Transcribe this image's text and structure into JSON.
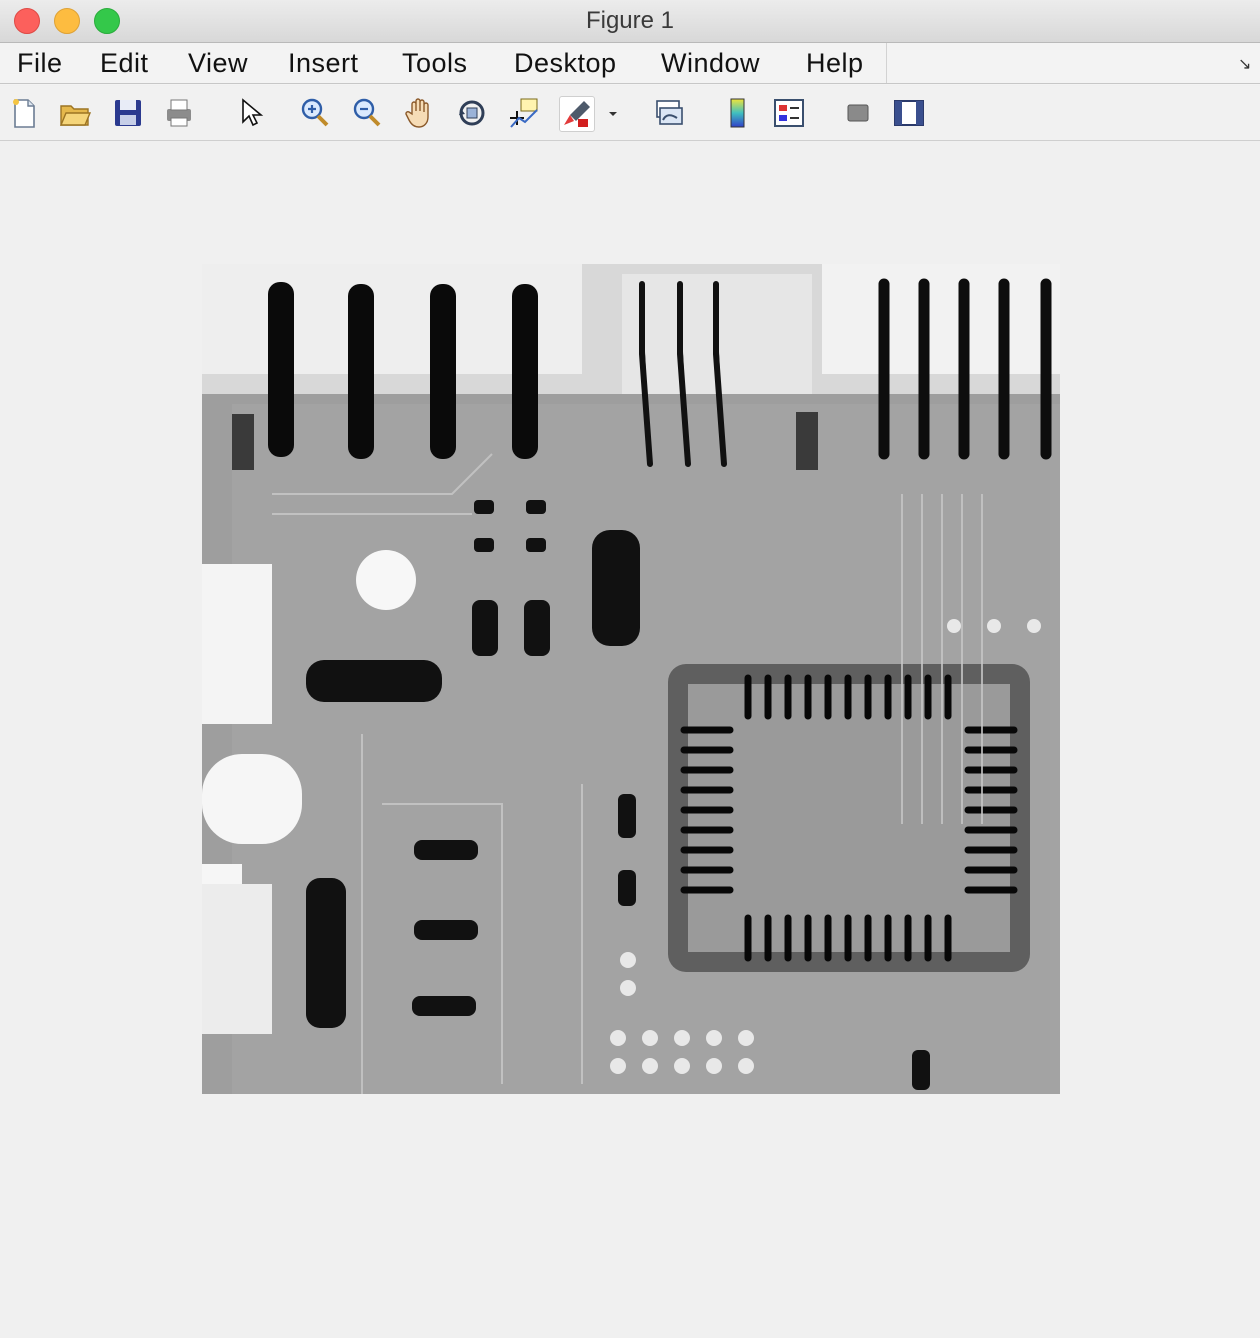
{
  "window": {
    "title": "Figure 1"
  },
  "menus": [
    "File",
    "Edit",
    "View",
    "Insert",
    "Tools",
    "Desktop",
    "Window",
    "Help"
  ],
  "toolbar": {
    "icons": [
      "new-figure-icon",
      "open-file-icon",
      "save-icon",
      "print-icon",
      "edit-plot-arrow-icon",
      "zoom-in-icon",
      "zoom-out-icon",
      "pan-hand-icon",
      "rotate-3d-icon",
      "data-cursor-icon",
      "brush-icon",
      "brush-dropdown-icon",
      "link-plot-icon",
      "colorbar-icon",
      "legend-icon",
      "hide-plot-tools-icon",
      "show-plot-tools-icon"
    ]
  },
  "figure": {
    "image_content": "grayscale X-ray of a printed circuit board"
  },
  "colors": {
    "titlebar": "#dcdcdc",
    "canvas": "#f0f0f0",
    "close": "#fc605c",
    "minimize": "#fdbc40",
    "maximize": "#34c84a"
  }
}
